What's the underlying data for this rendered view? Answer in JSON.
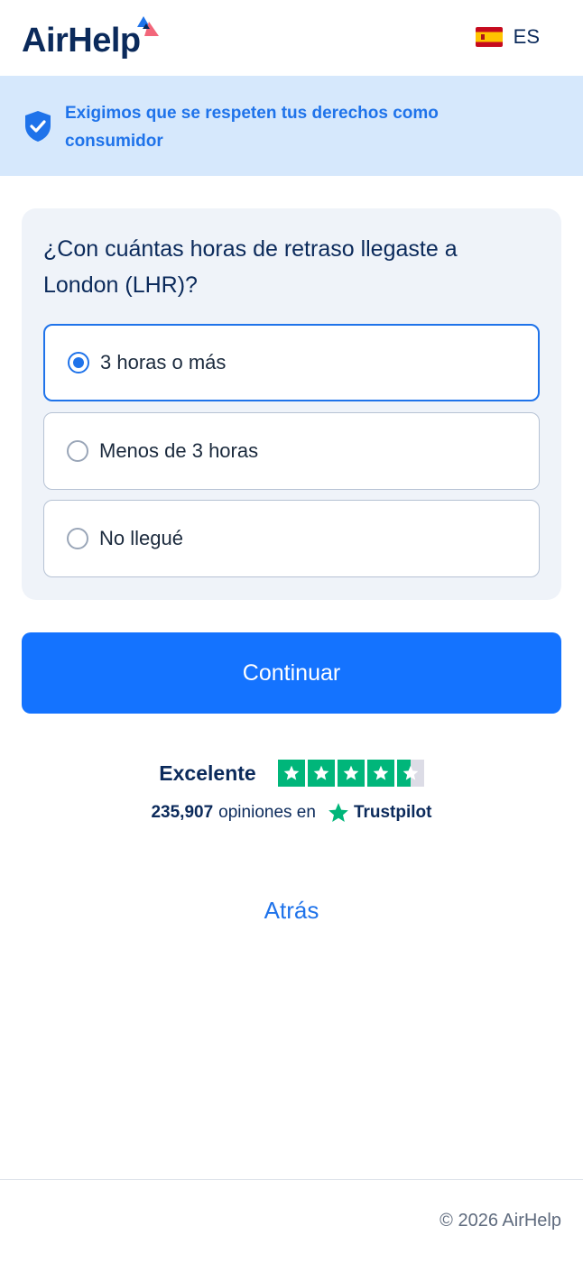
{
  "header": {
    "logo_text": "AirHelp",
    "language_code": "ES",
    "language_flag": "spain-flag"
  },
  "banner": {
    "text": "Exigimos que se respeten tus derechos como consumidor",
    "icon": "shield-check-icon"
  },
  "question": {
    "title": "¿Con cuántas horas de retraso llegaste a London (LHR)?",
    "options": [
      {
        "label": "3 horas o más",
        "selected": true
      },
      {
        "label": "Menos de 3 horas",
        "selected": false
      },
      {
        "label": "No llegué",
        "selected": false
      }
    ]
  },
  "continue_button": {
    "label": "Continuar"
  },
  "trustpilot": {
    "rating_label": "Excelente",
    "stars": 4.5,
    "reviews_count": "235,907",
    "reviews_text": "opiniones en",
    "brand": "Trustpilot"
  },
  "back_link": {
    "label": "Atrás"
  },
  "footer": {
    "copyright": "© 2026 AirHelp"
  },
  "colors": {
    "primary": "#1473ff",
    "brand_navy": "#0b2a5b",
    "banner_bg": "#d6e8fc",
    "trustpilot_green": "#00b67a"
  }
}
